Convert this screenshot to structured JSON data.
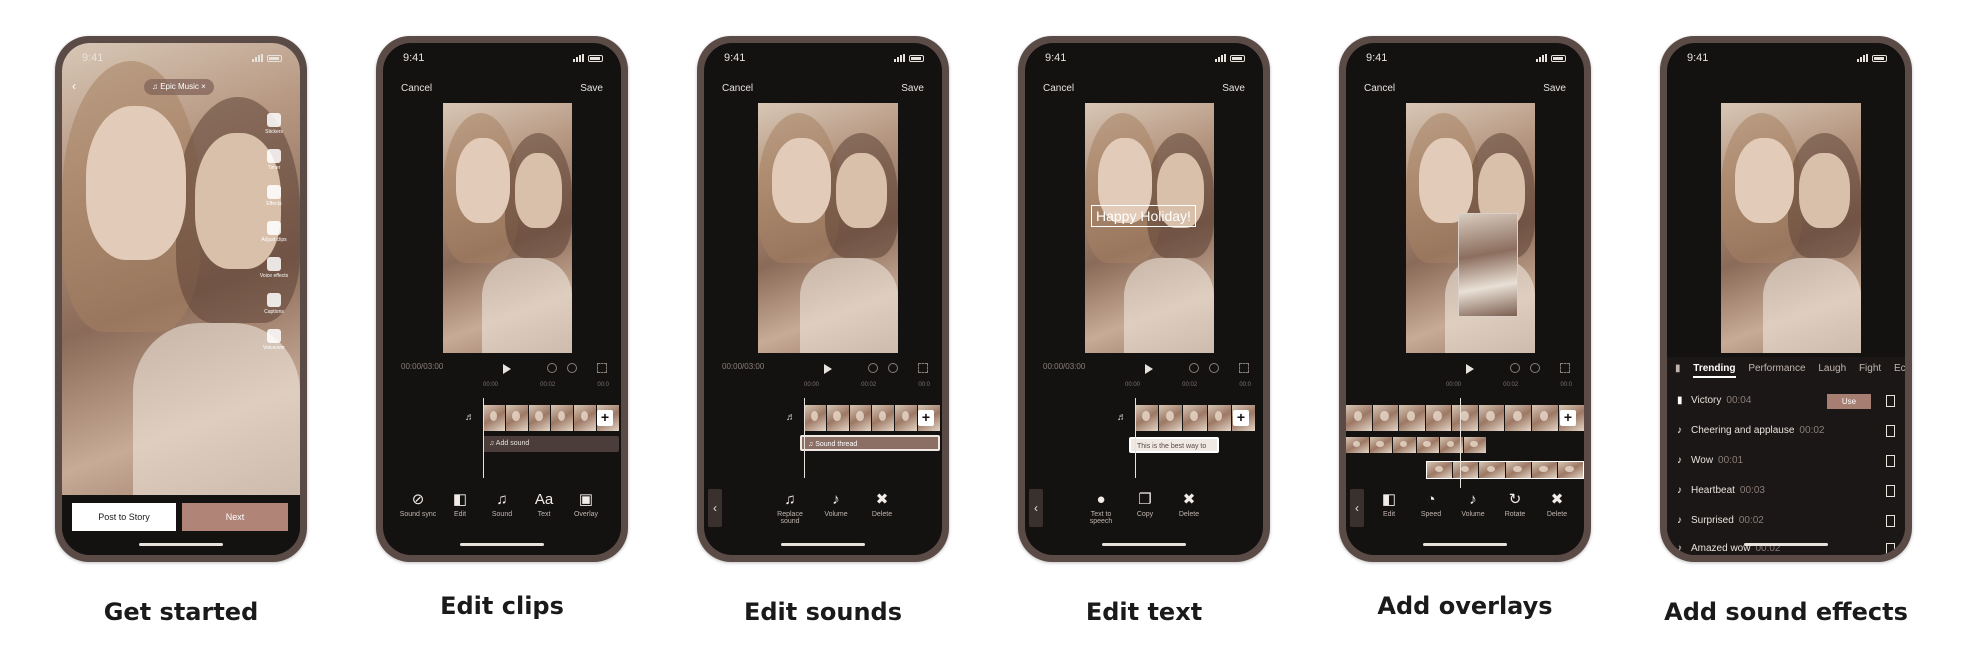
{
  "colors": {
    "phone_frame": "#5b4b47",
    "screen": "#141111",
    "accent": "#b08578",
    "caption": "#1a1a1a"
  },
  "status": {
    "time": "9:41"
  },
  "common": {
    "cancel": "Cancel",
    "save": "Save",
    "timecode": "00:00/03:00",
    "ruler": [
      "00:00",
      "00:02",
      "00:0"
    ]
  },
  "phone1": {
    "music_pill": "♫ Epic Music",
    "music_close": "×",
    "side_tools": [
      {
        "icon": "sticker-icon",
        "label": "Stickers"
      },
      {
        "icon": "timer-icon",
        "label": "Timer"
      },
      {
        "icon": "effects-icon",
        "label": "Effects"
      },
      {
        "icon": "adjust-clips-icon",
        "label": "Adjust clips"
      },
      {
        "icon": "voice-effects-icon",
        "label": "Voice effects"
      },
      {
        "icon": "captions-icon",
        "label": "Captions"
      },
      {
        "icon": "voiceover-icon",
        "label": "Voiceover"
      }
    ],
    "post_to_story": "Post to Story",
    "next": "Next",
    "caption": "Get started"
  },
  "phone2": {
    "add_sound": "♫ Add sound",
    "tools": [
      {
        "icon": "⊘",
        "label": "Sound sync"
      },
      {
        "icon": "◧",
        "label": "Edit"
      },
      {
        "icon": "♫",
        "label": "Sound"
      },
      {
        "icon": "Aa",
        "label": "Text"
      },
      {
        "icon": "▣",
        "label": "Overlay"
      }
    ],
    "caption": "Edit clips"
  },
  "phone3": {
    "sound_track": "♫ Sound thread",
    "tools": [
      {
        "icon": "♫",
        "label": "Replace sound"
      },
      {
        "icon": "♪",
        "label": "Volume"
      },
      {
        "icon": "✖",
        "label": "Delete"
      }
    ],
    "caption": "Edit sounds"
  },
  "phone4": {
    "overlay_text": "Happy Holiday!",
    "text_track": "This is the best way to",
    "tools": [
      {
        "icon": "●",
        "label": "Text to speech"
      },
      {
        "icon": "❐",
        "label": "Copy"
      },
      {
        "icon": "✖",
        "label": "Delete"
      }
    ],
    "caption": "Edit text"
  },
  "phone5": {
    "tools": [
      {
        "icon": "◧",
        "label": "Edit"
      },
      {
        "icon": "◔",
        "label": "Speed"
      },
      {
        "icon": "♪",
        "label": "Volume"
      },
      {
        "icon": "↻",
        "label": "Rotate"
      },
      {
        "icon": "✖",
        "label": "Delete"
      }
    ],
    "caption": "Add overlays"
  },
  "phone6": {
    "tabs": [
      "Trending",
      "Performance",
      "Laugh",
      "Fight",
      "Ec"
    ],
    "use": "Use",
    "sounds": [
      {
        "name": "Victory",
        "duration": "00:04"
      },
      {
        "name": "Cheering and applause",
        "duration": "00:02"
      },
      {
        "name": "Wow",
        "duration": "00:01"
      },
      {
        "name": "Heartbeat",
        "duration": "00:03"
      },
      {
        "name": "Surprised",
        "duration": "00:02"
      },
      {
        "name": "Amazed wow",
        "duration": "00:02"
      }
    ],
    "caption": "Add sound effects"
  }
}
